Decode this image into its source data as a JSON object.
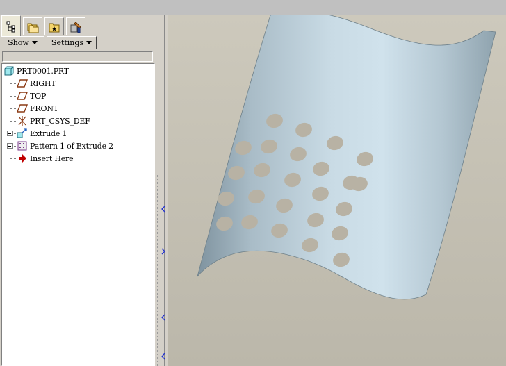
{
  "tabs": [
    {
      "name": "model-tree-tab",
      "icon": "model-tree-icon"
    },
    {
      "name": "folder-browser-tab",
      "icon": "folder-icon"
    },
    {
      "name": "favorites-tab",
      "icon": "favorites-icon"
    },
    {
      "name": "connections-tab",
      "icon": "tools-icon"
    }
  ],
  "toolbar": {
    "show_label": "Show",
    "settings_label": "Settings"
  },
  "tree": {
    "root": {
      "label": "PRT0001.PRT",
      "icon": "part-icon"
    },
    "items": [
      {
        "label": "RIGHT",
        "icon": "datum-plane-icon",
        "expandable": false
      },
      {
        "label": "TOP",
        "icon": "datum-plane-icon",
        "expandable": false
      },
      {
        "label": "FRONT",
        "icon": "datum-plane-icon",
        "expandable": false
      },
      {
        "label": "PRT_CSYS_DEF",
        "icon": "coordinate-system-icon",
        "expandable": false
      },
      {
        "label": "Extrude 1",
        "icon": "extrude-icon",
        "expandable": true
      },
      {
        "label": "Pattern 1 of Extrude 2",
        "icon": "pattern-icon",
        "expandable": true
      },
      {
        "label": "Insert Here",
        "icon": "insert-arrow-icon",
        "expandable": false
      }
    ]
  },
  "colors": {
    "background_top": "#ccc8bb",
    "background_bottom": "#bcb8ab",
    "surface_light": "#cfe0ea",
    "surface_dark": "#7e929e",
    "hole": "#b8b2a4",
    "insert_arrow": "#c00000"
  }
}
